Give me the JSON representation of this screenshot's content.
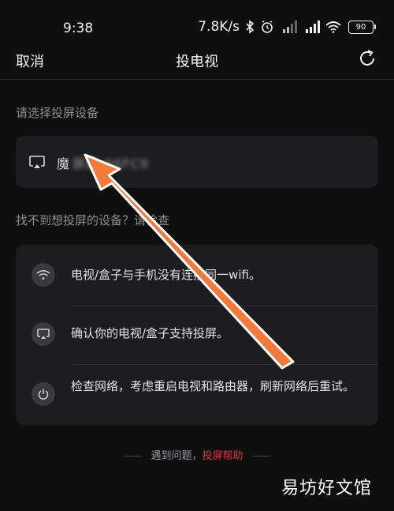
{
  "status_bar": {
    "time": "9:38",
    "network_speed": "7.8K/s",
    "battery": "90"
  },
  "header": {
    "cancel_label": "取消",
    "title": "投电视"
  },
  "select_label": "请选择投屏设备",
  "device": {
    "name_visible": "魔",
    "name_obscured": "屏幕-86FC9"
  },
  "not_found_label": "找不到想投屏的设备？请检查",
  "tips": [
    {
      "text": "电视/盒子与手机没有连接同一wifi。"
    },
    {
      "text": "确认你的电视/盒子支持投屏。"
    },
    {
      "text": "检查网络，考虑重启电视和路由器，刷新网络后重试。"
    }
  ],
  "footer": {
    "prefix": "遇到问题，",
    "link": "投屏帮助"
  },
  "watermark": "易坊好文馆",
  "colors": {
    "background": "#0f0f10",
    "card": "#1d1d20",
    "accent_red": "#e2353d",
    "arrow": "#f47a3c"
  }
}
